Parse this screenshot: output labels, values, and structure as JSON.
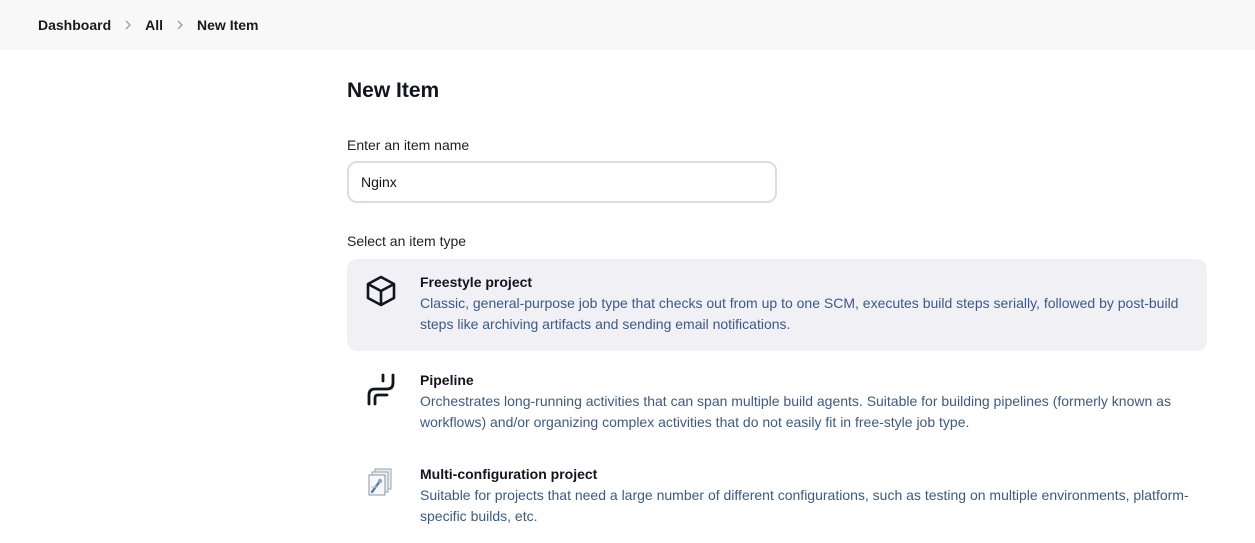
{
  "breadcrumb": {
    "items": [
      "Dashboard",
      "All",
      "New Item"
    ]
  },
  "page": {
    "title": "New Item"
  },
  "name_field": {
    "label": "Enter an item name",
    "value": "Nginx"
  },
  "item_types": {
    "label": "Select an item type",
    "items": [
      {
        "title": "Freestyle project",
        "description": "Classic, general-purpose job type that checks out from up to one SCM, executes build steps serially, followed by post-build steps like archiving artifacts and sending email notifications.",
        "icon": "package-cube-icon",
        "selected": true
      },
      {
        "title": "Pipeline",
        "description": "Orchestrates long-running activities that can span multiple build agents. Suitable for building pipelines (formerly known as workflows) and/or organizing complex activities that do not easily fit in free-style job type.",
        "icon": "pipeline-icon",
        "selected": false
      },
      {
        "title": "Multi-configuration project",
        "description": "Suitable for projects that need a large number of different configurations, such as testing on multiple environments, platform-specific builds, etc.",
        "icon": "multi-config-icon",
        "selected": false
      }
    ]
  },
  "colors": {
    "accent_text": "#3b5a8a",
    "selected_bg": "#f0f0f5",
    "breadcrumb_bg": "#f8f8f8"
  }
}
